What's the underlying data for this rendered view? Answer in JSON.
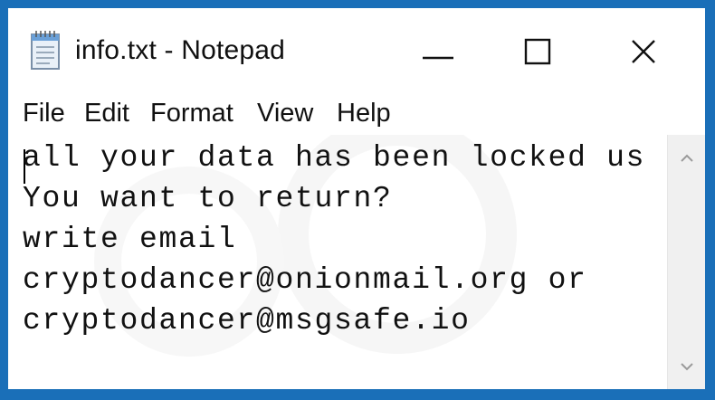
{
  "window": {
    "title": "info.txt - Notepad"
  },
  "title_icon": "notepad-icon",
  "controls": {
    "minimize": "minimize-icon",
    "maximize": "maximize-icon",
    "close": "close-icon"
  },
  "menu": {
    "items": [
      {
        "label": "File"
      },
      {
        "label": "Edit"
      },
      {
        "label": "Format"
      },
      {
        "label": "View"
      },
      {
        "label": "Help"
      }
    ]
  },
  "editor": {
    "lines": [
      "all your data has been locked us",
      "You want to return?",
      "write email",
      "cryptodancer@onionmail.org or",
      "cryptodancer@msgsafe.io"
    ]
  },
  "colors": {
    "frame": "#1a6fb8",
    "window_bg": "#ffffff",
    "text": "#111111",
    "scrollbar_bg": "#f0f0f0"
  }
}
